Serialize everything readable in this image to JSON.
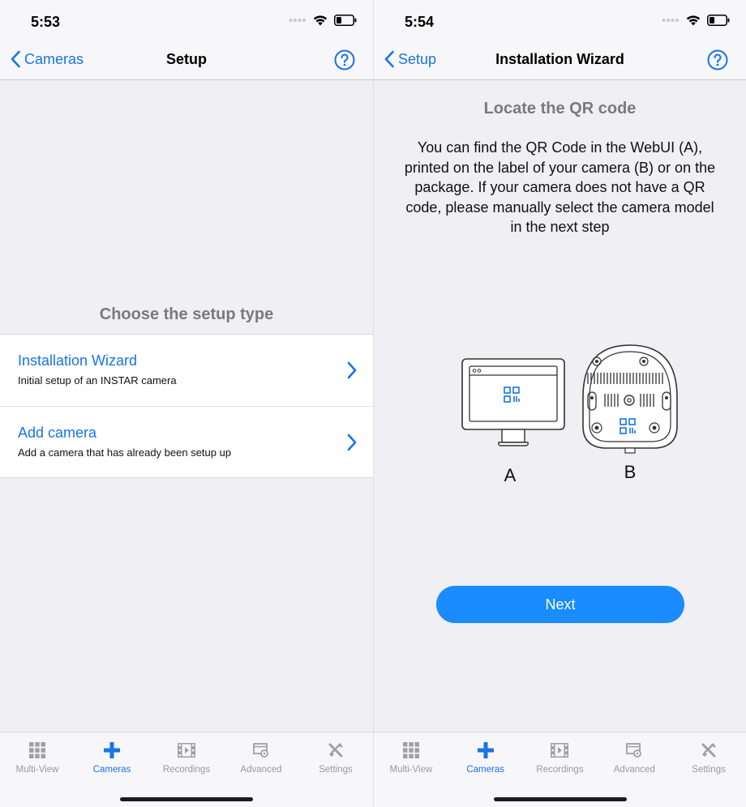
{
  "colors": {
    "accent": "#1a73e8",
    "button": "#1a8cff",
    "inactive": "#9a9a9e",
    "background": "#efeff4"
  },
  "screen1": {
    "status": {
      "time": "5:53"
    },
    "nav": {
      "back_label": "Cameras",
      "title": "Setup"
    },
    "heading": "Choose the setup type",
    "items": [
      {
        "title": "Installation Wizard",
        "subtitle": "Initial setup of an INSTAR camera"
      },
      {
        "title": "Add camera",
        "subtitle": "Add a camera that has already been setup up"
      }
    ]
  },
  "screen2": {
    "status": {
      "time": "5:54"
    },
    "nav": {
      "back_label": "Setup",
      "title": "Installation Wizard"
    },
    "heading": "Locate the QR code",
    "description": "You can find the QR Code in the WebUI (A), printed on the label of your camera (B) or on the package. If your camera does not have a QR code, please manually select the camera model in the next step",
    "label_a": "A",
    "label_b": "B",
    "next_label": "Next"
  },
  "tabbar": {
    "tabs": [
      {
        "label": "Multi-View",
        "icon": "grid-icon"
      },
      {
        "label": "Cameras",
        "icon": "plus-icon",
        "active": true
      },
      {
        "label": "Recordings",
        "icon": "film-icon"
      },
      {
        "label": "Advanced",
        "icon": "advanced-icon"
      },
      {
        "label": "Settings",
        "icon": "tools-icon"
      }
    ]
  }
}
